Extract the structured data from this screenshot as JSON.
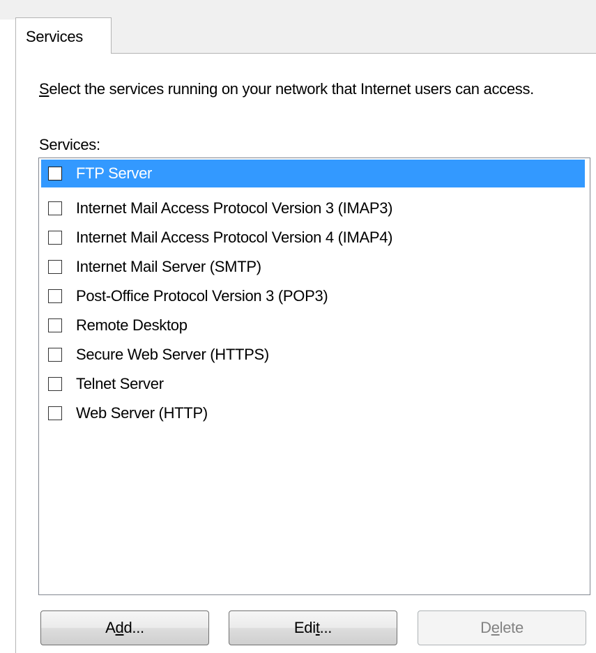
{
  "tab": {
    "label": "Services"
  },
  "instruction": {
    "mnemonic": "S",
    "text_rest": "elect the services running on your network that Internet users can access."
  },
  "list_label": "Services:",
  "services": [
    {
      "label": "FTP Server",
      "checked": false,
      "selected": true
    },
    {
      "label": "Internet Mail Access Protocol Version 3 (IMAP3)",
      "checked": false,
      "selected": false
    },
    {
      "label": "Internet Mail Access Protocol Version 4 (IMAP4)",
      "checked": false,
      "selected": false
    },
    {
      "label": "Internet Mail Server (SMTP)",
      "checked": false,
      "selected": false
    },
    {
      "label": "Post-Office Protocol Version 3 (POP3)",
      "checked": false,
      "selected": false
    },
    {
      "label": "Remote Desktop",
      "checked": false,
      "selected": false
    },
    {
      "label": "Secure Web Server (HTTPS)",
      "checked": false,
      "selected": false
    },
    {
      "label": "Telnet Server",
      "checked": false,
      "selected": false
    },
    {
      "label": "Web Server (HTTP)",
      "checked": false,
      "selected": false
    }
  ],
  "buttons": {
    "add": {
      "pre": "A",
      "mnemonic": "d",
      "post": "d...",
      "enabled": true
    },
    "edit": {
      "pre": "Edi",
      "mnemonic": "t",
      "post": "...",
      "enabled": true
    },
    "delete": {
      "pre": "D",
      "mnemonic": "e",
      "post": "lete",
      "enabled": false
    }
  },
  "colors": {
    "selection": "#3399ff",
    "selection_text": "#ffffff",
    "border": "#b4b4b4",
    "disabled_text": "#838383"
  }
}
